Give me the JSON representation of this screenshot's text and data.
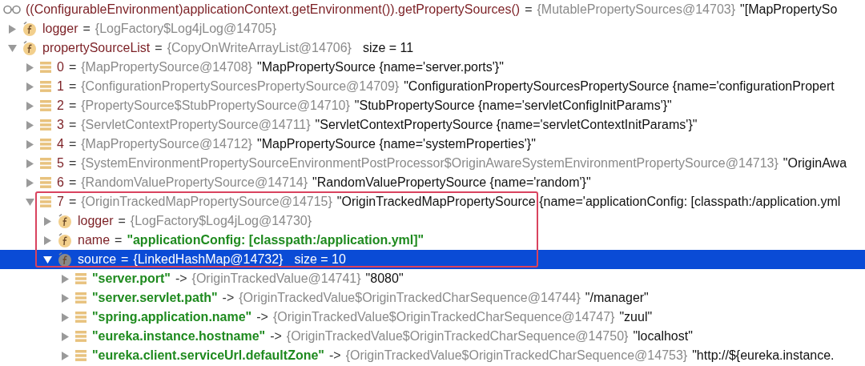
{
  "watch": {
    "expression": "((ConfigurableEnvironment)applicationContext.getEnvironment()).getPropertySources()",
    "op": "=",
    "type": "{MutablePropertySources@14703}",
    "value": "\"[MapPropertySo"
  },
  "tree": [
    {
      "kind": "field",
      "name": "logger",
      "op": "=",
      "type": "{LogFactory$Log4jLog@14705}",
      "expanded": false,
      "selected": false
    },
    {
      "kind": "field",
      "name": "propertySourceList",
      "op": "=",
      "type": "{CopyOnWriteArrayList@14706}",
      "size": "size = 11",
      "expanded": true,
      "selected": false,
      "children": [
        {
          "kind": "element",
          "name": "0",
          "op": "=",
          "type": "{MapPropertySource@14708}",
          "value": "\"MapPropertySource {name='server.ports'}\"",
          "expanded": false,
          "selected": false
        },
        {
          "kind": "element",
          "name": "1",
          "op": "=",
          "type": "{ConfigurationPropertySourcesPropertySource@14709}",
          "value": "\"ConfigurationPropertySourcesPropertySource {name='configurationPropert",
          "expanded": false,
          "selected": false
        },
        {
          "kind": "element",
          "name": "2",
          "op": "=",
          "type": "{PropertySource$StubPropertySource@14710}",
          "value": "\"StubPropertySource {name='servletConfigInitParams'}\"",
          "expanded": false,
          "selected": false
        },
        {
          "kind": "element",
          "name": "3",
          "op": "=",
          "type": "{ServletContextPropertySource@14711}",
          "value": "\"ServletContextPropertySource {name='servletContextInitParams'}\"",
          "expanded": false,
          "selected": false
        },
        {
          "kind": "element",
          "name": "4",
          "op": "=",
          "type": "{MapPropertySource@14712}",
          "value": "\"MapPropertySource {name='systemProperties'}\"",
          "expanded": false,
          "selected": false
        },
        {
          "kind": "element",
          "name": "5",
          "op": "=",
          "type": "{SystemEnvironmentPropertySourceEnvironmentPostProcessor$OriginAwareSystemEnvironmentPropertySource@14713}",
          "value": "\"OriginAwa",
          "expanded": false,
          "selected": false
        },
        {
          "kind": "element",
          "name": "6",
          "op": "=",
          "type": "{RandomValuePropertySource@14714}",
          "value": "\"RandomValuePropertySource {name='random'}\"",
          "expanded": false,
          "selected": false
        },
        {
          "kind": "element",
          "name": "7",
          "op": "=",
          "type": "{OriginTrackedMapPropertySource@14715}",
          "value": "\"OriginTrackedMapPropertySource {name='applicationConfig: [classpath:/application.yml",
          "expanded": true,
          "selected": false,
          "children": [
            {
              "kind": "field",
              "name": "logger",
              "op": "=",
              "type": "{LogFactory$Log4jLog@14730}",
              "expanded": false,
              "selected": false
            },
            {
              "kind": "field",
              "name": "name",
              "op": "=",
              "value": "\"applicationConfig: [classpath:/application.yml]\"",
              "string_value": true,
              "expanded": false,
              "selected": false
            },
            {
              "kind": "field",
              "name": "source",
              "op": "=",
              "type": "{LinkedHashMap@14732}",
              "size": "size = 10",
              "expanded": true,
              "selected": true,
              "children": [
                {
                  "kind": "entry",
                  "name": "\"server.port\"",
                  "op": "->",
                  "type": "{OriginTrackedValue@14741}",
                  "value": "\"8080\"",
                  "expanded": false,
                  "selected": false
                },
                {
                  "kind": "entry",
                  "name": "\"server.servlet.path\"",
                  "op": "->",
                  "type": "{OriginTrackedValue$OriginTrackedCharSequence@14744}",
                  "value": "\"/manager\"",
                  "expanded": false,
                  "selected": false
                },
                {
                  "kind": "entry",
                  "name": "\"spring.application.name\"",
                  "op": "->",
                  "type": "{OriginTrackedValue$OriginTrackedCharSequence@14747}",
                  "value": "\"zuul\"",
                  "expanded": false,
                  "selected": false
                },
                {
                  "kind": "entry",
                  "name": "\"eureka.instance.hostname\"",
                  "op": "->",
                  "type": "{OriginTrackedValue$OriginTrackedCharSequence@14750}",
                  "value": "\"localhost\"",
                  "expanded": false,
                  "selected": false
                },
                {
                  "kind": "entry",
                  "name": "\"eureka.client.serviceUrl.defaultZone\"",
                  "op": "->",
                  "type": "{OriginTrackedValue$OriginTrackedCharSequence@14753}",
                  "value": "\"http://${eureka.instance.",
                  "expanded": false,
                  "selected": false
                }
              ]
            }
          ]
        }
      ]
    }
  ],
  "highlight": {
    "kind": "frame"
  }
}
